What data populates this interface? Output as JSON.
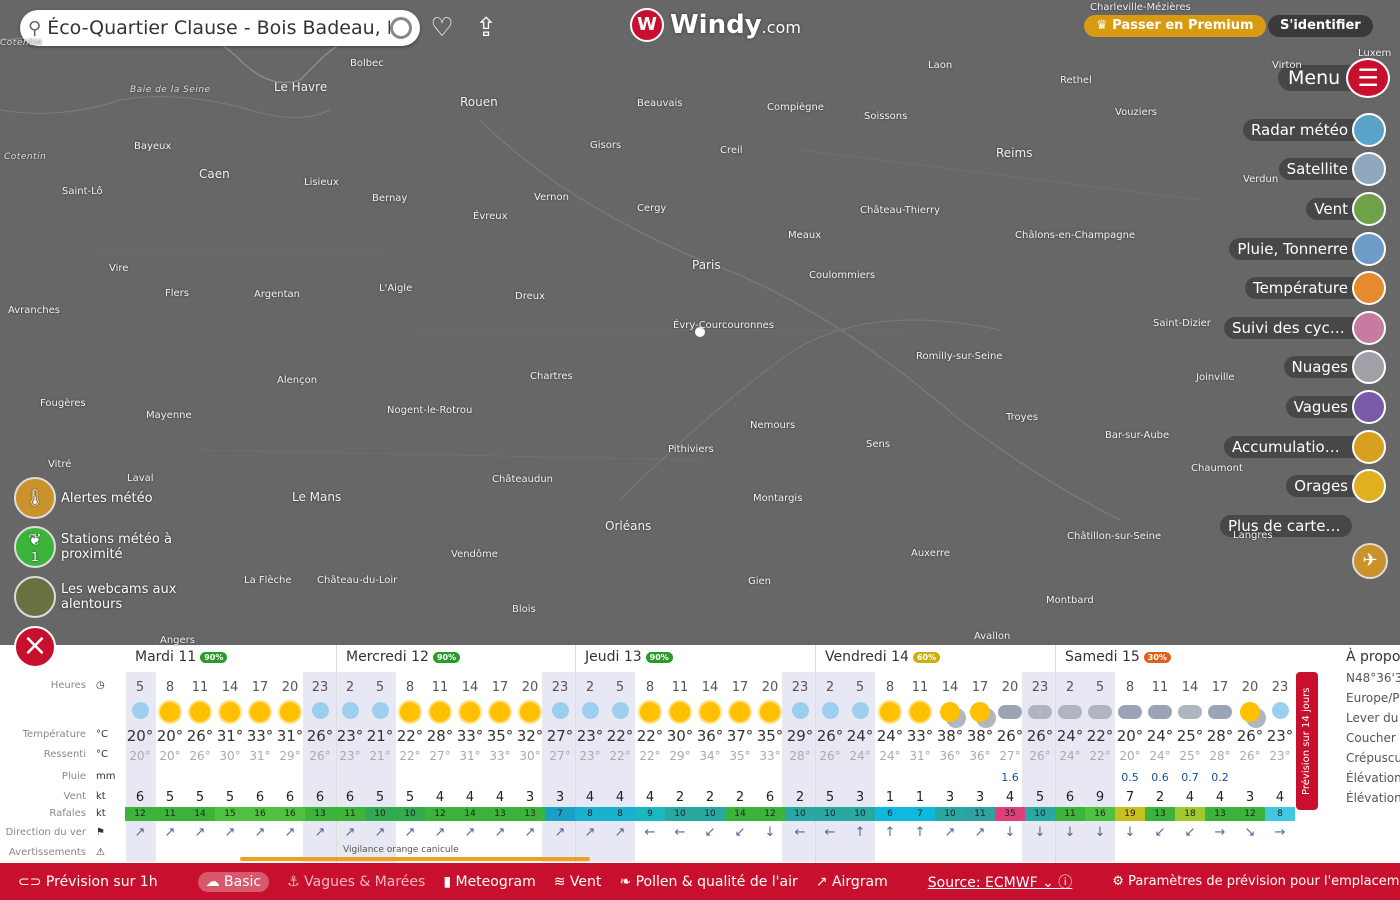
{
  "search": {
    "value": "Éco-Quartier Clause - Bois Badeau, B"
  },
  "logo": {
    "name": "Windy",
    "suffix": ".com"
  },
  "header": {
    "premium": "♛ Passer en Premium",
    "login": "S'identifier"
  },
  "menu": {
    "label": "Menu"
  },
  "layers": [
    {
      "label": "Radar météo",
      "color": "#5aa3c8"
    },
    {
      "label": "Satellite",
      "color": "#8fa8c0"
    },
    {
      "label": "Vent",
      "color": "#6fa14a"
    },
    {
      "label": "Pluie, Tonnerre",
      "color": "#6e9bc8"
    },
    {
      "label": "Température",
      "color": "#e68a2e"
    },
    {
      "label": "Suivi des cycl...",
      "color": "#c87aa0"
    },
    {
      "label": "Nuages",
      "color": "#a0a0a8"
    },
    {
      "label": "Vagues",
      "color": "#7a5aa8"
    },
    {
      "label": "Accumulation...",
      "color": "#d8a020"
    },
    {
      "label": "Orages",
      "color": "#e0b020"
    },
    {
      "label": "Plus de cartes...",
      "color": ""
    }
  ],
  "left": {
    "alerts": "Alertes météo",
    "stations": "Stations météo à proximité",
    "stations_count": "1",
    "webcams": "Les webcams aux alentours"
  },
  "map_labels": [
    {
      "t": "Cotentin",
      "c": "region"
    },
    {
      "t": "Le Havre",
      "c": "big"
    },
    {
      "t": "Bolbec",
      "c": ""
    },
    {
      "t": "Baie de la Seine",
      "c": "region"
    },
    {
      "t": "Rouen",
      "c": "big"
    },
    {
      "t": "Beauvais",
      "c": ""
    },
    {
      "t": "Compiègne",
      "c": ""
    },
    {
      "t": "Laon",
      "c": ""
    },
    {
      "t": "Soissons",
      "c": ""
    },
    {
      "t": "Rethel",
      "c": ""
    },
    {
      "t": "Vouziers",
      "c": ""
    },
    {
      "t": "Charleville-Mézières",
      "c": ""
    },
    {
      "t": "Bayeux",
      "c": ""
    },
    {
      "t": "Caen",
      "c": "big"
    },
    {
      "t": "Gisors",
      "c": ""
    },
    {
      "t": "Creil",
      "c": ""
    },
    {
      "t": "Reims",
      "c": "big"
    },
    {
      "t": "Verdun",
      "c": ""
    },
    {
      "t": "Cotentin",
      "c": "region"
    },
    {
      "t": "Saint-Lô",
      "c": ""
    },
    {
      "t": "Lisieux",
      "c": ""
    },
    {
      "t": "Bernay",
      "c": ""
    },
    {
      "t": "Évreux",
      "c": ""
    },
    {
      "t": "Vernon",
      "c": ""
    },
    {
      "t": "Cergy",
      "c": ""
    },
    {
      "t": "Château-Thierry",
      "c": ""
    },
    {
      "t": "Meaux",
      "c": ""
    },
    {
      "t": "Châlons-en-Champagne",
      "c": ""
    },
    {
      "t": "Paris",
      "c": "big"
    },
    {
      "t": "Vire",
      "c": ""
    },
    {
      "t": "Flers",
      "c": ""
    },
    {
      "t": "Argentan",
      "c": ""
    },
    {
      "t": "L'Aigle",
      "c": ""
    },
    {
      "t": "Dreux",
      "c": ""
    },
    {
      "t": "Coulommiers",
      "c": ""
    },
    {
      "t": "Avranches",
      "c": ""
    },
    {
      "t": "Évry-Courcouronnes",
      "c": ""
    },
    {
      "t": "Saint-Dizier",
      "c": ""
    },
    {
      "t": "Romilly-sur-Seine",
      "c": ""
    },
    {
      "t": "Alençon",
      "c": ""
    },
    {
      "t": "Chartres",
      "c": ""
    },
    {
      "t": "Joinville",
      "c": ""
    },
    {
      "t": "Fougères",
      "c": ""
    },
    {
      "t": "Mayenne",
      "c": ""
    },
    {
      "t": "Nogent-le-Rotrou",
      "c": ""
    },
    {
      "t": "Nemours",
      "c": ""
    },
    {
      "t": "Troyes",
      "c": ""
    },
    {
      "t": "Pithiviers",
      "c": ""
    },
    {
      "t": "Sens",
      "c": ""
    },
    {
      "t": "Bar-sur-Aube",
      "c": ""
    },
    {
      "t": "Vitré",
      "c": ""
    },
    {
      "t": "Laval",
      "c": ""
    },
    {
      "t": "Châteaudun",
      "c": ""
    },
    {
      "t": "Chaumont",
      "c": ""
    },
    {
      "t": "Le Mans",
      "c": "big"
    },
    {
      "t": "Montargis",
      "c": ""
    },
    {
      "t": "Orléans",
      "c": "big"
    },
    {
      "t": "Vendôme",
      "c": ""
    },
    {
      "t": "Châtillon-sur-Seine",
      "c": ""
    },
    {
      "t": "Langres",
      "c": ""
    },
    {
      "t": "La Flèche",
      "c": ""
    },
    {
      "t": "Château-du-Loir",
      "c": ""
    },
    {
      "t": "Gien",
      "c": ""
    },
    {
      "t": "Auxerre",
      "c": ""
    },
    {
      "t": "Blois",
      "c": ""
    },
    {
      "t": "Montbard",
      "c": ""
    },
    {
      "t": "Angers",
      "c": ""
    },
    {
      "t": "Avallon",
      "c": ""
    },
    {
      "t": "Virton",
      "c": ""
    },
    {
      "t": "Luxem",
      "c": ""
    }
  ],
  "forecast": {
    "rows": {
      "heures": "Heures",
      "temp": "Température",
      "ressenti": "Ressenti",
      "pluie": "Pluie",
      "vent": "Vent",
      "rafales": "Rafales",
      "direction": "Direction du ver",
      "avert": "Avertissements"
    },
    "units": {
      "temp": "°C",
      "ressenti": "°C",
      "pluie": "mm",
      "vent": "kt",
      "rafales": "kt"
    },
    "days": [
      {
        "label": "Mardi 11",
        "prob": "90%",
        "color": "#2a9a2a"
      },
      {
        "label": "Mercredi 12",
        "prob": "90%",
        "color": "#2a9a2a"
      },
      {
        "label": "Jeudi 13",
        "prob": "90%",
        "color": "#2a9a2a"
      },
      {
        "label": "Vendredi 14",
        "prob": "60%",
        "color": "#c8b010"
      },
      {
        "label": "Samedi 15",
        "prob": "30%",
        "color": "#e0601a"
      }
    ],
    "hours": [
      "5",
      "8",
      "11",
      "14",
      "17",
      "20",
      "23",
      "2",
      "5",
      "8",
      "11",
      "14",
      "17",
      "20",
      "23",
      "2",
      "5",
      "8",
      "11",
      "14",
      "17",
      "20",
      "23",
      "2",
      "5",
      "8",
      "11",
      "14",
      "17",
      "20",
      "23",
      "2",
      "5",
      "8",
      "11",
      "14",
      "17",
      "20",
      "23"
    ],
    "icons": [
      "moon",
      "sun",
      "sun",
      "sun",
      "sun",
      "sun",
      "moon",
      "moon",
      "moon",
      "sun",
      "sun",
      "sun",
      "sun",
      "sun",
      "moon",
      "moon",
      "moon",
      "sun",
      "sun",
      "sun",
      "sun",
      "sun",
      "moon",
      "moon",
      "moon",
      "sun",
      "sun",
      "sunc",
      "sunc",
      "rain",
      "cloud",
      "cloud",
      "cloud",
      "rain",
      "rain",
      "cloud",
      "rain",
      "sunc",
      "moon"
    ],
    "temps": [
      "20°",
      "20°",
      "26°",
      "31°",
      "33°",
      "31°",
      "26°",
      "23°",
      "21°",
      "22°",
      "28°",
      "33°",
      "35°",
      "32°",
      "27°",
      "23°",
      "22°",
      "22°",
      "30°",
      "36°",
      "37°",
      "35°",
      "29°",
      "26°",
      "24°",
      "24°",
      "33°",
      "38°",
      "38°",
      "26°",
      "26°",
      "24°",
      "22°",
      "20°",
      "24°",
      "25°",
      "28°",
      "26°",
      "23°"
    ],
    "feels": [
      "20°",
      "20°",
      "26°",
      "30°",
      "31°",
      "29°",
      "26°",
      "23°",
      "21°",
      "22°",
      "27°",
      "31°",
      "33°",
      "30°",
      "27°",
      "23°",
      "22°",
      "22°",
      "29°",
      "34°",
      "35°",
      "33°",
      "28°",
      "26°",
      "24°",
      "24°",
      "31°",
      "36°",
      "36°",
      "27°",
      "26°",
      "24°",
      "22°",
      "20°",
      "24°",
      "25°",
      "28°",
      "26°",
      "23°"
    ],
    "rain": [
      "",
      "",
      "",
      "",
      "",
      "",
      "",
      "",
      "",
      "",
      "",
      "",
      "",
      "",
      "",
      "",
      "",
      "",
      "",
      "",
      "",
      "",
      "",
      "",
      "",
      "",
      "",
      "",
      "",
      "1.6",
      "",
      "",
      "",
      "0.5",
      "0.6",
      "0.7",
      "0.2",
      "",
      ""
    ],
    "wind": [
      "6",
      "5",
      "5",
      "5",
      "6",
      "6",
      "6",
      "6",
      "5",
      "5",
      "4",
      "4",
      "4",
      "3",
      "3",
      "4",
      "4",
      "4",
      "2",
      "2",
      "2",
      "6",
      "2",
      "5",
      "3",
      "1",
      "1",
      "3",
      "3",
      "4",
      "5",
      "6",
      "9",
      "7",
      "2",
      "4",
      "4",
      "3",
      "4"
    ],
    "gust": [
      "12",
      "11",
      "14",
      "15",
      "16",
      "16",
      "13",
      "11",
      "10",
      "10",
      "12",
      "14",
      "13",
      "13",
      "7",
      "8",
      "8",
      "9",
      "10",
      "10",
      "14",
      "12",
      "10",
      "10",
      "10",
      "6",
      "7",
      "10",
      "11",
      "35",
      "10",
      "11",
      "16",
      "19",
      "13",
      "18",
      "13",
      "12",
      "8"
    ],
    "gust_colors": [
      "#3cb43c",
      "#3cb43c",
      "#3cb43c",
      "#50c040",
      "#50c040",
      "#50c040",
      "#3cb43c",
      "#3cb43c",
      "#34aa50",
      "#34aa50",
      "#3cb43c",
      "#3cb43c",
      "#3cb43c",
      "#3cb43c",
      "#1aa0c8",
      "#1ab0d0",
      "#1ab0d0",
      "#1ab8c0",
      "#28a8a0",
      "#28a8a0",
      "#3cb43c",
      "#3cb43c",
      "#28a8a0",
      "#28a8a0",
      "#28a8a0",
      "#10b8e0",
      "#10b8e0",
      "#28a8a0",
      "#30a0a0",
      "#e0407a",
      "#28a8a0",
      "#3cb43c",
      "#50c040",
      "#c8c020",
      "#3cb43c",
      "#a0c830",
      "#3cb43c",
      "#3cb43c",
      "#40c8e0"
    ],
    "dirs": [
      "↗",
      "↗",
      "↗",
      "↗",
      "↗",
      "↗",
      "↗",
      "↗",
      "↗",
      "↗",
      "↗",
      "↗",
      "↗",
      "↗",
      "↗",
      "↗",
      "↗",
      "←",
      "←",
      "↙",
      "↙",
      "↓",
      "←",
      "←",
      "↑",
      "↑",
      "↑",
      "↗",
      "↗",
      "↓",
      "↓",
      "↓",
      "↓",
      "↓",
      "↙",
      "↙",
      "→",
      "↘",
      "→"
    ],
    "warning": "Vigilance orange canicule",
    "side": "Prévision sur 14 jours",
    "info": [
      "À propo",
      "N48°36'3",
      "Europe/P",
      "Lever du",
      "Coucher",
      "Crépuscu",
      "Élévation",
      "Élévation"
    ]
  },
  "bottom": {
    "hourly": "Prévision sur 1h",
    "basic": "Basic",
    "waves": "Vagues & Marées",
    "meteogram": "Meteogram",
    "wind": "Vent",
    "pollen": "Pollen & qualité de l'air",
    "airgram": "Airgram",
    "source": "Source: ECMWF",
    "settings": "Paramètres de prévision pour l'emplacement"
  }
}
